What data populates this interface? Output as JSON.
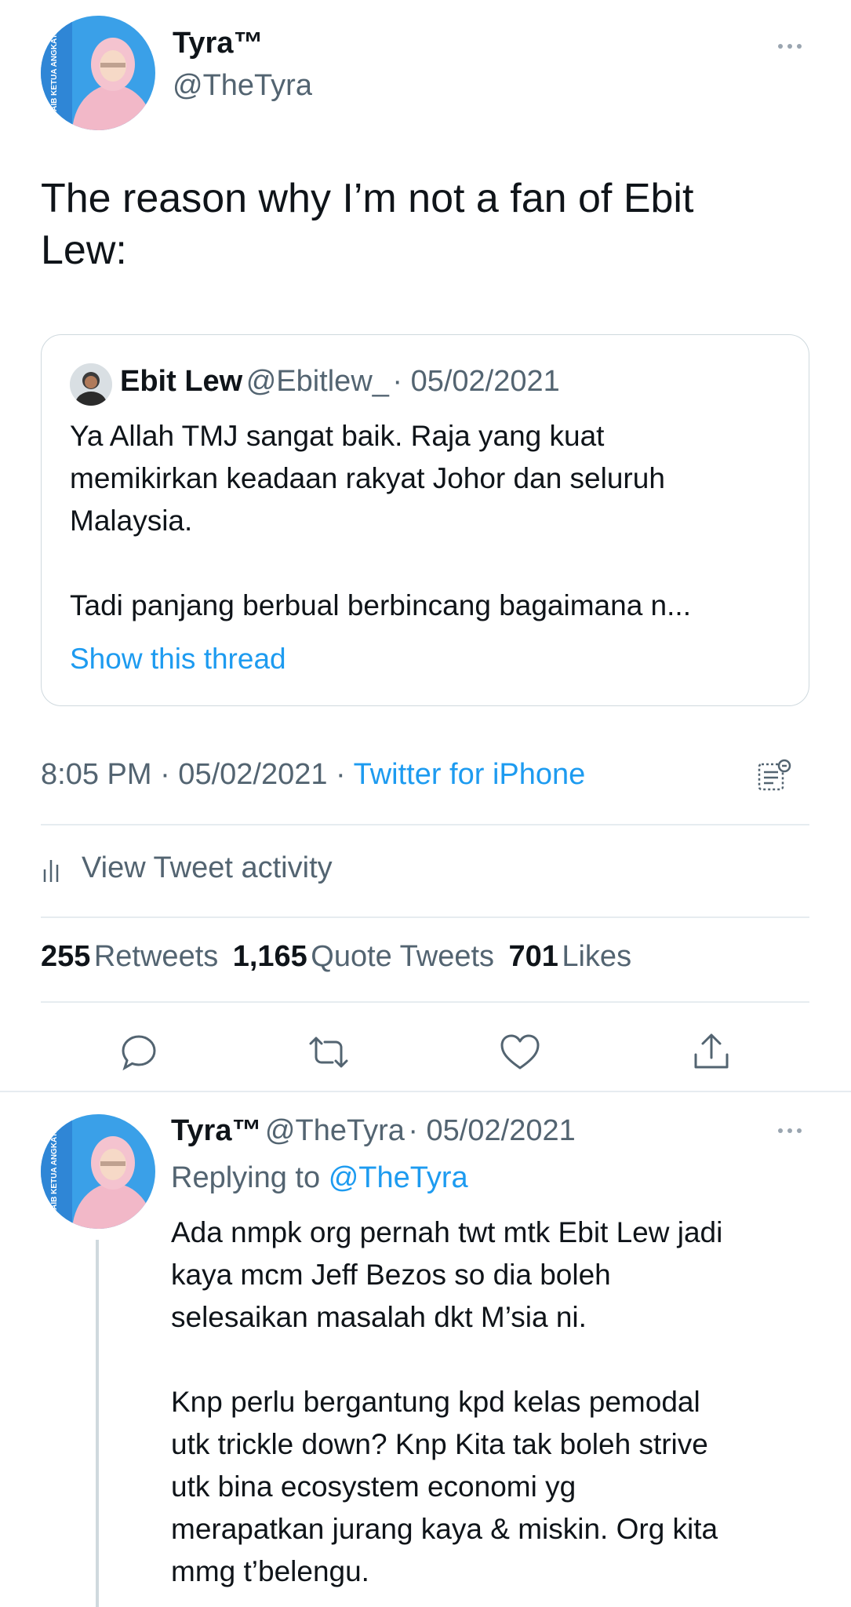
{
  "main_tweet": {
    "display_name": "Tyra™",
    "handle": "@TheTyra",
    "text": "The reason why I’m not a fan of Ebit\nLew:",
    "avatar_banner_text": "NAIB KETUA ANGKATA MUDA KEADILAN"
  },
  "quoted_tweet": {
    "display_name": "Ebit Lew",
    "handle": "@Ebitlew_",
    "date": "· 05/02/2021",
    "text": "Ya Allah TMJ sangat baik. Raja yang kuat\nmemikirkan keadaan rakyat Johor dan seluruh\nMalaysia.\n\nTadi panjang berbual berbincang bagaimana n...",
    "show_thread": "Show this thread"
  },
  "timestamp": {
    "time": "8:05 PM",
    "date": "· 05/02/2021 ·",
    "source": "Twitter for iPhone"
  },
  "activity": {
    "label": "View Tweet activity"
  },
  "stats": {
    "retweets_count": "255",
    "retweets_label": "Retweets",
    "quotes_count": "1,165",
    "quotes_label": "Quote Tweets",
    "likes_count": "701",
    "likes_label": "Likes"
  },
  "actions": {
    "reply_icon": "reply-icon",
    "retweet_icon": "retweet-icon",
    "like_icon": "heart-icon",
    "share_icon": "share-icon"
  },
  "reply_tweet": {
    "display_name": "Tyra™",
    "handle": "@TheTyra",
    "date": "· 05/02/2021",
    "replying_prefix": "Replying to",
    "replying_handle": "@TheTyra",
    "text": "Ada nmpk org pernah twt mtk Ebit Lew jadi\nkaya mcm Jeff Bezos so dia boleh\nselesaikan masalah dkt M’sia ni.\n\nKnp perlu bergantung kpd kelas pemodal\nutk trickle down? Knp Kita tak boleh strive\nutk bina ecosystem economi yg\nmerapatkan jurang kaya & miskin. Org kita\nmmg t’belengu."
  },
  "colors": {
    "accent": "#1d9bf0",
    "secondary_text": "#536471",
    "divider": "#e6ecf0"
  }
}
